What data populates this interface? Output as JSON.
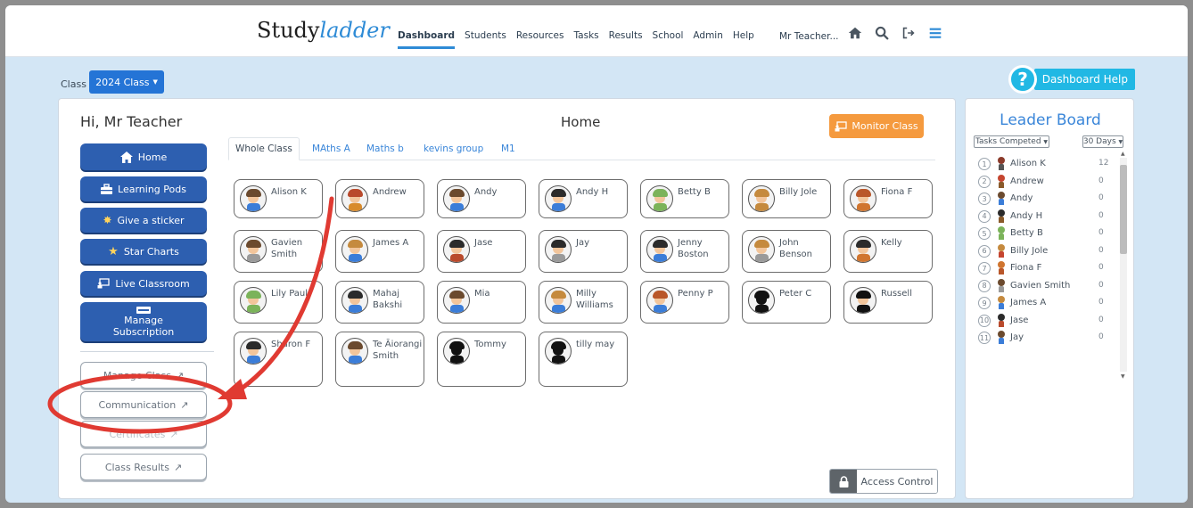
{
  "header": {
    "logo_plain": "Study",
    "logo_italic": "ladder",
    "nav": [
      "Dashboard",
      "Students",
      "Resources",
      "Tasks",
      "Results",
      "School",
      "Admin",
      "Help"
    ],
    "teacher": "Mr Teacher...",
    "icons": [
      "home-icon",
      "search-icon",
      "logout-icon",
      "menu-icon"
    ]
  },
  "classbar": {
    "label": "Class",
    "selected": "2024 Class",
    "help_label": "Dashboard Help",
    "help_glyph": "?"
  },
  "panel": {
    "greeting": "Hi, Mr Teacher",
    "title": "Home",
    "monitor_label": "Monitor Class",
    "menu": [
      {
        "label": "Home",
        "icon": "home-icon"
      },
      {
        "label": "Learning Pods",
        "icon": "pods-icon"
      },
      {
        "label": "Give a sticker",
        "icon": "sticker-icon"
      },
      {
        "label": "Star Charts",
        "icon": "star-icon"
      },
      {
        "label": "Live Classroom",
        "icon": "classroom-icon"
      },
      {
        "label": "Manage Subscription",
        "icon": "subscription-icon"
      }
    ],
    "links": [
      {
        "label": "Manage Class"
      },
      {
        "label": "Communication"
      },
      {
        "label": "Certificates"
      },
      {
        "label": "Class Results"
      }
    ],
    "tabs": [
      "Whole Class",
      "MAths A",
      "Maths b",
      "kevins group",
      "M1"
    ],
    "students": [
      [
        "Alison K",
        "Andrew",
        "Andy",
        "Andy H",
        "Betty B",
        "Billy Jole",
        "Fiona F"
      ],
      [
        "Gavien Smith",
        "James A",
        "Jase",
        "Jay",
        "Jenny Boston",
        "John Benson",
        "Kelly"
      ],
      [
        "Lily Paul",
        "Mahaj Bakshi",
        "Mia",
        "Milly Williams",
        "Penny P",
        "Peter C",
        "Russell"
      ],
      [
        "Sharon F",
        "Te Āiorangi Smith",
        "Tommy",
        "tilly may"
      ]
    ],
    "access_label": "Access Control"
  },
  "leaderboard": {
    "title": "Leader Board",
    "filter": "Tasks Competed",
    "period": "30 Days",
    "rows": [
      {
        "rank": "1",
        "name": "Alison K",
        "score": "12"
      },
      {
        "rank": "2",
        "name": "Andrew",
        "score": "0"
      },
      {
        "rank": "3",
        "name": "Andy",
        "score": "0"
      },
      {
        "rank": "4",
        "name": "Andy H",
        "score": "0"
      },
      {
        "rank": "5",
        "name": "Betty B",
        "score": "0"
      },
      {
        "rank": "6",
        "name": "Billy Jole",
        "score": "0"
      },
      {
        "rank": "7",
        "name": "Fiona F",
        "score": "0"
      },
      {
        "rank": "8",
        "name": "Gavien Smith",
        "score": "0"
      },
      {
        "rank": "9",
        "name": "James A",
        "score": "0"
      },
      {
        "rank": "10",
        "name": "Jase",
        "score": "0"
      },
      {
        "rank": "11",
        "name": "Jay",
        "score": "0"
      }
    ]
  },
  "colors": {
    "brand_blue": "#2e8bd6",
    "menu_blue": "#2d5fb0",
    "monitor_orange": "#f59a3e",
    "annotation_red": "#e03a32"
  }
}
